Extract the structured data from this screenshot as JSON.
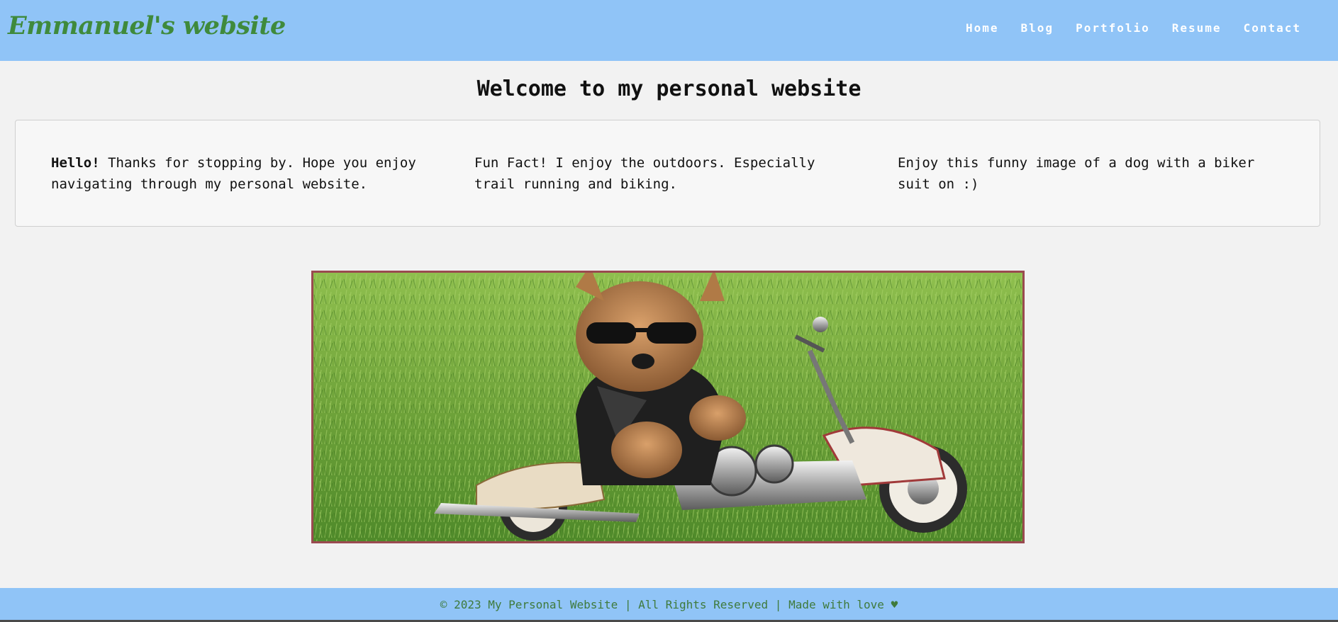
{
  "header": {
    "logo": "Emmanuel's website",
    "nav": [
      "Home",
      "Blog",
      "Portfolio",
      "Resume",
      "Contact"
    ]
  },
  "main": {
    "title": "Welcome to my personal website",
    "columns": [
      {
        "bold": "Hello!",
        "text": " Thanks for stopping by. Hope you enjoy navigating through my personal website."
      },
      {
        "bold": "",
        "text": "Fun Fact! I enjoy the outdoors. Especially trail running and biking."
      },
      {
        "bold": "",
        "text": "Enjoy this funny image of a dog with a biker suit on :)"
      }
    ],
    "image_alt": "dog in a leather biker jacket and sunglasses on a toy motorcycle in the grass"
  },
  "footer": {
    "text": "© 2023 My Personal Website | All Rights Reserved | Made with love ♥"
  },
  "colors": {
    "header_bg": "#90c4f7",
    "logo": "#3f8a3c",
    "footer_text": "#3f7a3c",
    "image_border": "#9a4a50",
    "page_bg": "#f2f2f2"
  }
}
